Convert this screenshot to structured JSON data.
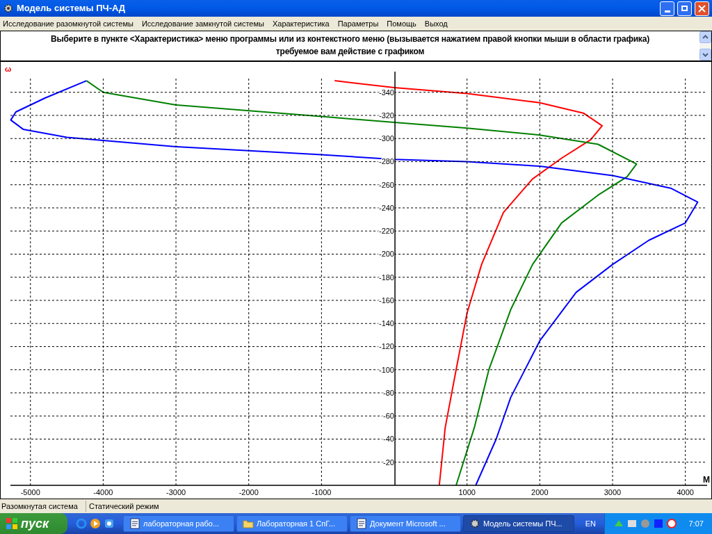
{
  "window": {
    "title": "Модель системы ПЧ-АД"
  },
  "menu": [
    "Исследование разомкнутой системы",
    "Исследование замкнутой системы",
    "Характеристика",
    "Параметры",
    "Помощь",
    "Выход"
  ],
  "message": {
    "lines": [
      "Выберите в пункте <Характеристика> меню программы или из контекстного меню (вызывается нажатием правой кнопки мыши в области графика)",
      "требуемое вам действие с графиком"
    ]
  },
  "plot": {
    "chart_data": {
      "type": "line",
      "grid": true,
      "xlabel": "M",
      "ylabel": "ω",
      "xlim": [
        -5380,
        4290
      ],
      "ylim": [
        0,
        -366
      ],
      "xticks": [
        -5000,
        -4000,
        -3000,
        -2000,
        -1000,
        1000,
        2000,
        3000,
        4000
      ],
      "yticks": [
        -20,
        -40,
        -60,
        -80,
        -100,
        -120,
        -140,
        -160,
        -180,
        -200,
        -220,
        -240,
        -260,
        -280,
        -300,
        -320,
        -340
      ],
      "series": [
        {
          "color": "#ff0000",
          "x": [
            -819,
            0,
            1000,
            2000,
            2600,
            2857,
            2700,
            2300,
            1900,
            1500,
            1200,
            1000,
            850,
            700,
            619
          ],
          "values": [
            -350,
            -344,
            -339,
            -331,
            -322,
            -311,
            -299,
            -283,
            -265,
            -236,
            -191,
            -149,
            -100,
            -50,
            0
          ]
        },
        {
          "color": "#008000",
          "x": [
            -4230,
            -4000,
            -3000,
            -1000,
            0,
            1000,
            2000,
            2800,
            3330,
            3200,
            2800,
            2300,
            1900,
            1600,
            1300,
            1100,
            850
          ],
          "values": [
            -350,
            -340,
            -329,
            -319,
            -314,
            -309,
            -303,
            -295,
            -278,
            -267,
            -251,
            -227,
            -191,
            -152,
            -100,
            -50,
            0
          ]
        },
        {
          "color": "#0000ff",
          "x": [
            -4230,
            -4800,
            -5200,
            -5270,
            -5100,
            -4500,
            -3000,
            -1000,
            0,
            1000,
            2000,
            3000,
            3800,
            4170,
            4000,
            3500,
            3000,
            2500,
            2000,
            1600,
            1400,
            1120
          ],
          "values": [
            -350,
            -335,
            -323,
            -316,
            -308,
            -301,
            -293,
            -286,
            -282,
            -280,
            -276,
            -268,
            -257,
            -245,
            -227,
            -212,
            -191,
            -167,
            -125,
            -76,
            -40,
            0
          ]
        }
      ]
    }
  },
  "status_bar": [
    "Разомкнутая система",
    "Статический режим"
  ],
  "taskbar": {
    "start": "пуск",
    "tasks": [
      {
        "label": "лабораторная рабо...",
        "kind": "doc",
        "selected": false
      },
      {
        "label": "Лабораторная 1 СпГ...",
        "kind": "folder",
        "selected": false
      },
      {
        "label": "Документ Microsoft ...",
        "kind": "doc",
        "selected": false
      },
      {
        "label": "Модель системы ПЧ...",
        "kind": "app",
        "selected": true
      }
    ],
    "language": "EN",
    "clock": "7:07"
  }
}
